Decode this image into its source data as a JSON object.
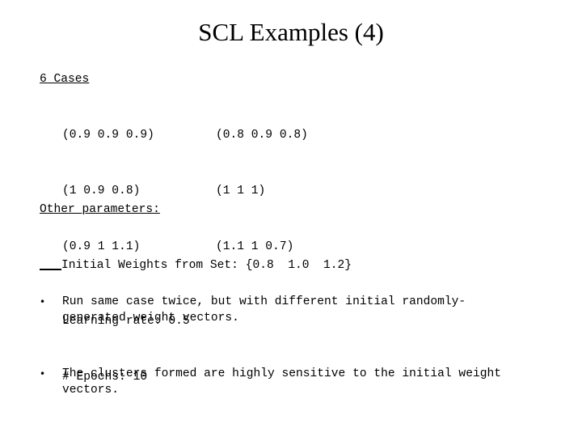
{
  "title": "SCL Examples (4)",
  "cases": {
    "heading": "6 Cases",
    "left_column": [
      "(0.9 0.9 0.9)",
      "(1 0.9 0.8)",
      "(0.9 1 1.1)"
    ],
    "right_column": [
      "(0.8 0.9 0.8)",
      "(1 1 1)",
      "(1.1 1 0.7)"
    ]
  },
  "parameters": {
    "heading": "Other parameters:",
    "items": [
      "Initial Weights from Set: {0.8  1.0  1.2}",
      "Learning rate: 0.5",
      "# Epochs: 10"
    ]
  },
  "bullets": [
    {
      "icon": "bullet-dot",
      "glyph": "•",
      "text": "Run same case twice, but with different initial randomly-generated weight vectors."
    },
    {
      "icon": "bullet-dot",
      "glyph": "•",
      "text": "The clusters formed are highly sensitive to the initial weight vectors."
    }
  ]
}
